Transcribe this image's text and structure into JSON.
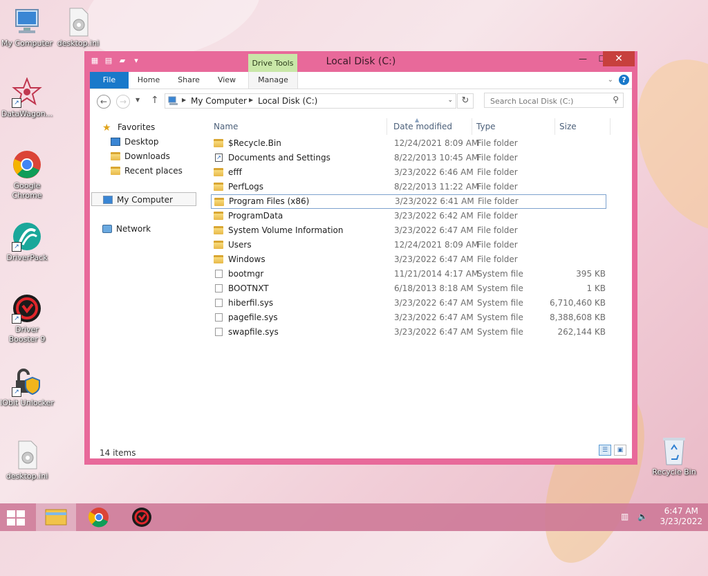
{
  "desktop": {
    "icons": [
      {
        "label": "My Computer"
      },
      {
        "label": "desktop.ini"
      },
      {
        "label": "DataWagon..."
      },
      {
        "label": "Google Chrome"
      },
      {
        "label": "DriverPack"
      },
      {
        "label": "Driver Booster 9"
      },
      {
        "label": "IObit Unlocker"
      },
      {
        "label": "desktop.ini"
      },
      {
        "label": "Recycle Bin"
      }
    ]
  },
  "window": {
    "title": "Local Disk (C:)",
    "contextual_tab_group": "Drive Tools",
    "ribbon_tabs": [
      "File",
      "Home",
      "Share",
      "View",
      "Manage"
    ],
    "controls": {
      "minimize": "—",
      "maximize": "☐",
      "close": "✕"
    }
  },
  "address": {
    "breadcrumbs": [
      "My Computer",
      "Local Disk (C:)"
    ],
    "search_placeholder": "Search Local Disk (C:)"
  },
  "navpane": {
    "favorites": "Favorites",
    "favorites_items": [
      "Desktop",
      "Downloads",
      "Recent places"
    ],
    "my_computer": "My Computer",
    "network": "Network"
  },
  "columns": [
    "Name",
    "Date modified",
    "Type",
    "Size"
  ],
  "files": [
    {
      "name": "$Recycle.Bin",
      "date": "12/24/2021 8:09 AM",
      "type": "File folder",
      "size": "",
      "kind": "folder"
    },
    {
      "name": "Documents and Settings",
      "date": "8/22/2013 10:45 AM",
      "type": "File folder",
      "size": "",
      "kind": "shortcut"
    },
    {
      "name": "efff",
      "date": "3/23/2022 6:46 AM",
      "type": "File folder",
      "size": "",
      "kind": "folder"
    },
    {
      "name": "PerfLogs",
      "date": "8/22/2013 11:22 AM",
      "type": "File folder",
      "size": "",
      "kind": "folder"
    },
    {
      "name": "Program Files (x86)",
      "date": "3/23/2022 6:41 AM",
      "type": "File folder",
      "size": "",
      "kind": "folder",
      "selected": true
    },
    {
      "name": "ProgramData",
      "date": "3/23/2022 6:42 AM",
      "type": "File folder",
      "size": "",
      "kind": "folder"
    },
    {
      "name": "System Volume Information",
      "date": "3/23/2022 6:47 AM",
      "type": "File folder",
      "size": "",
      "kind": "folder"
    },
    {
      "name": "Users",
      "date": "12/24/2021 8:09 AM",
      "type": "File folder",
      "size": "",
      "kind": "folder"
    },
    {
      "name": "Windows",
      "date": "3/23/2022 6:47 AM",
      "type": "File folder",
      "size": "",
      "kind": "folder"
    },
    {
      "name": "bootmgr",
      "date": "11/21/2014 4:17 AM",
      "type": "System file",
      "size": "395 KB",
      "kind": "file"
    },
    {
      "name": "BOOTNXT",
      "date": "6/18/2013 8:18 AM",
      "type": "System file",
      "size": "1 KB",
      "kind": "file"
    },
    {
      "name": "hiberfil.sys",
      "date": "3/23/2022 6:47 AM",
      "type": "System file",
      "size": "6,710,460 KB",
      "kind": "file"
    },
    {
      "name": "pagefile.sys",
      "date": "3/23/2022 6:47 AM",
      "type": "System file",
      "size": "8,388,608 KB",
      "kind": "file"
    },
    {
      "name": "swapfile.sys",
      "date": "3/23/2022 6:47 AM",
      "type": "System file",
      "size": "262,144 KB",
      "kind": "file"
    }
  ],
  "status": {
    "item_count": "14 items"
  },
  "taskbar": {
    "time": "6:47 AM",
    "date": "3/23/2022"
  }
}
